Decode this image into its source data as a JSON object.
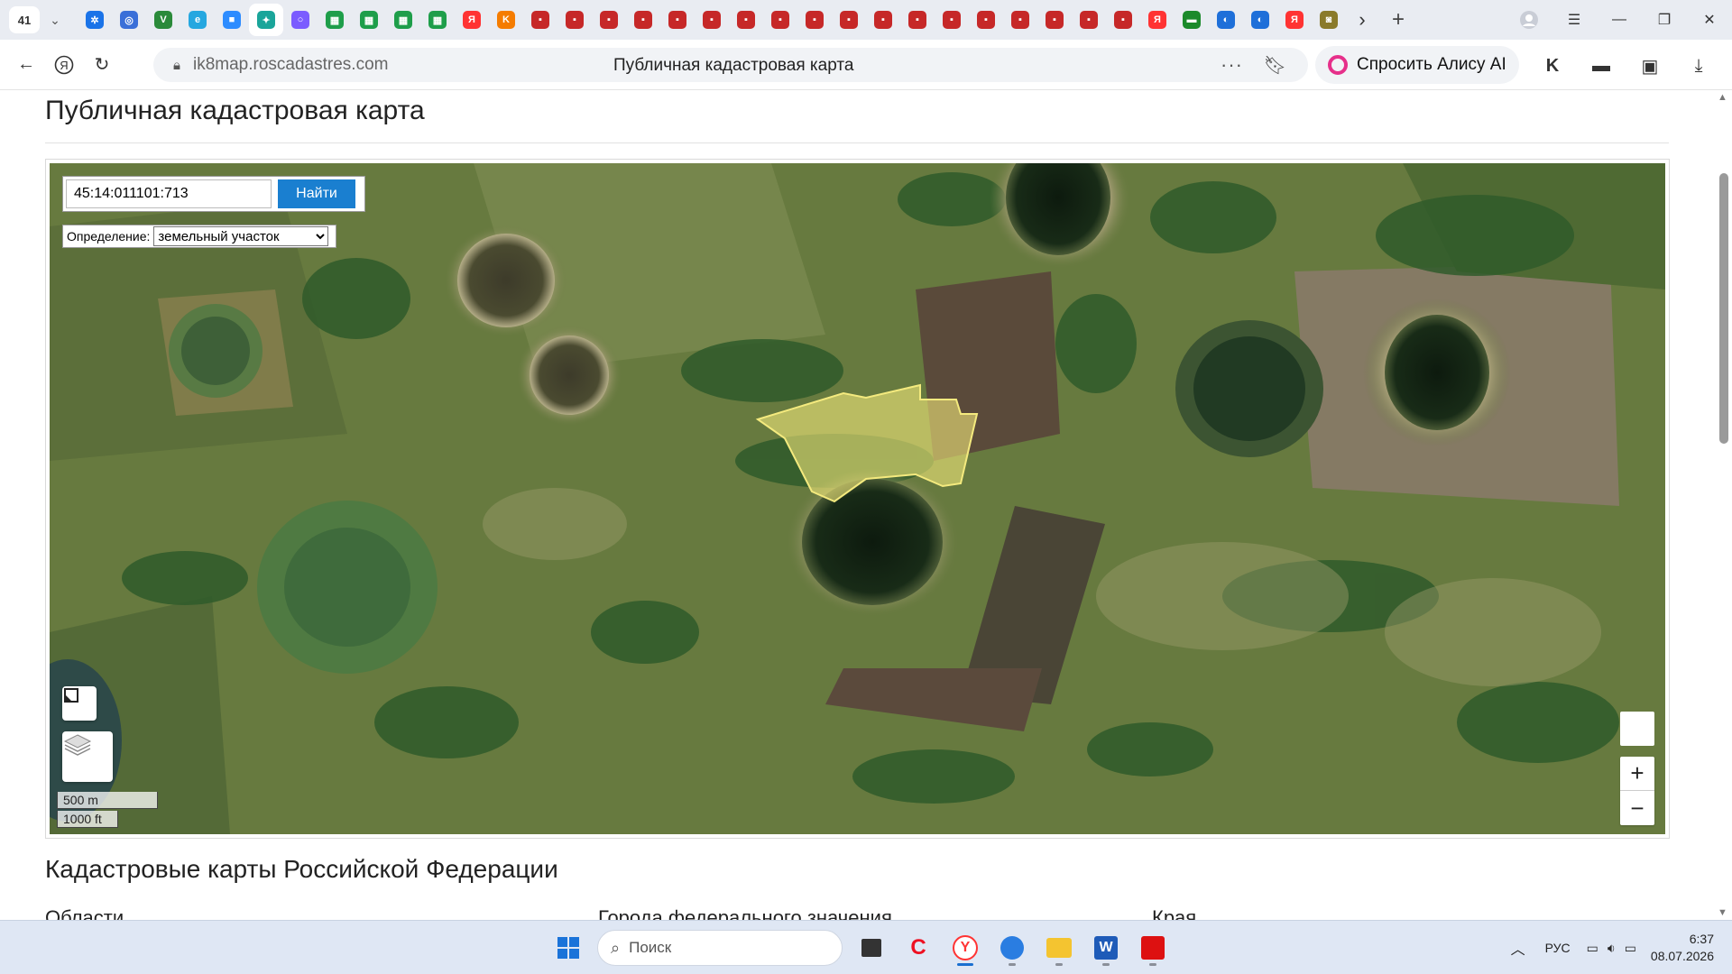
{
  "browser": {
    "tab_count": "41",
    "url": "ik8map.roscadastres.com",
    "page_title": "Публичная кадастровая карта",
    "alice_label": "Спросить Алису AI",
    "tab_icons": [
      {
        "icon": "app-icon",
        "color": "#1a73e8",
        "glyph": "✲"
      },
      {
        "icon": "globe-icon",
        "color": "#3a6fd8",
        "glyph": "◎"
      },
      {
        "icon": "shield-icon",
        "color": "#2a8a3a",
        "glyph": "V"
      },
      {
        "icon": "app-icon",
        "color": "#25a7e0",
        "glyph": "e"
      },
      {
        "icon": "video-icon",
        "color": "#2d8cff",
        "glyph": "■"
      },
      {
        "icon": "ai-icon",
        "color": "#1aa59a",
        "glyph": "✦"
      },
      {
        "icon": "alice-icon",
        "color": "#7b5cff",
        "glyph": "○"
      },
      {
        "icon": "sheet-icon",
        "color": "#1e9e4a",
        "glyph": "▦"
      },
      {
        "icon": "sheet-icon",
        "color": "#1e9e4a",
        "glyph": "▦"
      },
      {
        "icon": "sheet-icon",
        "color": "#1e9e4a",
        "glyph": "▦"
      },
      {
        "icon": "sheet-icon",
        "color": "#1e9e4a",
        "glyph": "▦"
      },
      {
        "icon": "yandex-icon",
        "color": "#f33",
        "glyph": "Я"
      },
      {
        "icon": "app-icon",
        "color": "#f57c00",
        "glyph": "K"
      },
      {
        "icon": "document-icon",
        "color": "#c62828",
        "glyph": "▪"
      },
      {
        "icon": "document-icon",
        "color": "#c62828",
        "glyph": "▪"
      },
      {
        "icon": "document-icon",
        "color": "#c62828",
        "glyph": "▪"
      },
      {
        "icon": "document-icon",
        "color": "#c62828",
        "glyph": "▪"
      },
      {
        "icon": "document-icon",
        "color": "#c62828",
        "glyph": "▪"
      },
      {
        "icon": "document-icon",
        "color": "#c62828",
        "glyph": "▪"
      },
      {
        "icon": "document-icon",
        "color": "#c62828",
        "glyph": "▪"
      },
      {
        "icon": "document-icon",
        "color": "#c62828",
        "glyph": "▪"
      },
      {
        "icon": "document-icon",
        "color": "#c62828",
        "glyph": "▪"
      },
      {
        "icon": "document-icon",
        "color": "#c62828",
        "glyph": "▪"
      },
      {
        "icon": "document-icon",
        "color": "#c62828",
        "glyph": "▪"
      },
      {
        "icon": "document-icon",
        "color": "#c62828",
        "glyph": "▪"
      },
      {
        "icon": "document-icon",
        "color": "#c62828",
        "glyph": "▪"
      },
      {
        "icon": "document-icon",
        "color": "#c62828",
        "glyph": "▪"
      },
      {
        "icon": "document-icon",
        "color": "#c62828",
        "glyph": "▪"
      },
      {
        "icon": "document-icon",
        "color": "#c62828",
        "glyph": "▪"
      },
      {
        "icon": "document-icon",
        "color": "#c62828",
        "glyph": "▪"
      },
      {
        "icon": "document-icon",
        "color": "#c62828",
        "glyph": "▪"
      },
      {
        "icon": "yandex-icon",
        "color": "#f33",
        "glyph": "Я"
      },
      {
        "icon": "flag-icon",
        "color": "#1b8a2b",
        "glyph": "▬"
      },
      {
        "icon": "edge-icon",
        "color": "#1e6fd9",
        "glyph": "◐"
      },
      {
        "icon": "edge-icon",
        "color": "#1e6fd9",
        "glyph": "◐"
      },
      {
        "icon": "yandex-icon",
        "color": "#f33",
        "glyph": "Я"
      },
      {
        "icon": "app-icon",
        "color": "#8a7a2a",
        "glyph": "◙"
      }
    ],
    "active_tab_index": 5
  },
  "page": {
    "title": "Публичная кадастровая карта",
    "section_title": "Кадастровые карты Российской Федерации",
    "columns": [
      "Области",
      "Города федерального значения",
      "Края"
    ]
  },
  "map": {
    "search_value": "45:14:011101:713",
    "search_button": "Найти",
    "definition_label": "Определение:",
    "definition_selected": "земельный участок",
    "scale_metric": "500 m",
    "scale_imperial": "1000 ft",
    "zoom_in": "+",
    "zoom_out": "−",
    "highlight_color": "#f2e77a"
  },
  "taskbar": {
    "search_placeholder": "Поиск",
    "language": "РУС",
    "time": "6:37",
    "date": "08.07.2026"
  }
}
